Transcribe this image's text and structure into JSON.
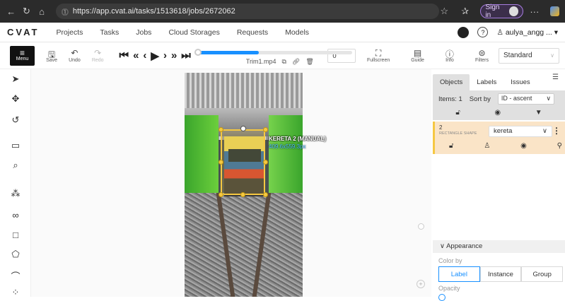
{
  "browser": {
    "url": "https://app.cvat.ai/tasks/1513618/jobs/2672062",
    "sign_in": "Sign in"
  },
  "nav": {
    "logo": "CVAT",
    "items": [
      "Projects",
      "Tasks",
      "Jobs",
      "Cloud Storages",
      "Requests",
      "Models"
    ],
    "user": "aulya_angg ..."
  },
  "toolbar": {
    "menu": "Menu",
    "save": "Save",
    "undo": "Undo",
    "redo": "Redo",
    "filename": "Trim1.mp4",
    "frame": "0",
    "fullscreen": "Fullscreen",
    "guide": "Guide",
    "info": "Info",
    "filters": "Filters",
    "workspace": "Standard",
    "progress": 0.4
  },
  "canvas": {
    "box_label": "KERETA 2 (MANUAL)",
    "box_size": "409.6x559.3px"
  },
  "sidebar": {
    "tabs": [
      "Objects",
      "Labels",
      "Issues"
    ],
    "items_label": "Items: 1",
    "sort_label": "Sort by",
    "sort_value": "ID - ascent",
    "object": {
      "id": "2",
      "type": "RECTANGLE SHAPE",
      "label": "kereta"
    },
    "appearance": "Appearance",
    "color_by": "Color by",
    "color_options": [
      "Label",
      "Instance",
      "Group"
    ],
    "opacity": "Opacity"
  },
  "colors": {
    "accent": "#1890ff",
    "box": "#f5c842",
    "object_card": "#fae4c7"
  }
}
